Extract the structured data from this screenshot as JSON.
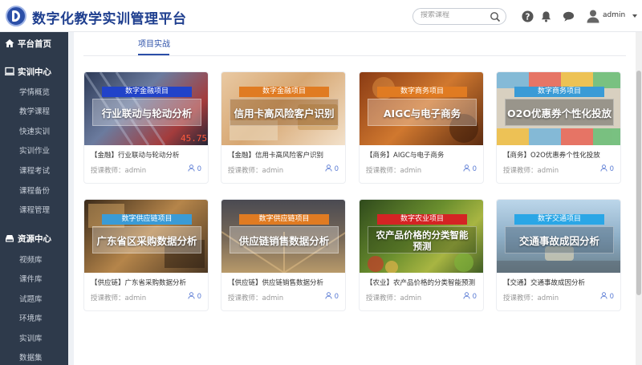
{
  "header": {
    "title": "数字化教学实训管理平台",
    "search_placeholder": "搜索课程",
    "user": "admin"
  },
  "sidebar": {
    "home": "平台首页",
    "sections": [
      {
        "label": "实训中心",
        "items": [
          "学情概览",
          "教学课程",
          "快速实训",
          "实训作业",
          "课程考试",
          "课程备份",
          "课程管理"
        ]
      },
      {
        "label": "资源中心",
        "items": [
          "视频库",
          "课件库",
          "试题库",
          "环境库",
          "实训库",
          "数据集"
        ]
      }
    ]
  },
  "main": {
    "tab": "项目实战",
    "cards": [
      {
        "tag": "数字金融项目",
        "cover_title": "行业联动与轮动分析",
        "name": "【金融】行业联动与轮动分析",
        "teacher": "授课教师：admin",
        "count": "0",
        "tag_color": "#2143c9"
      },
      {
        "tag": "数字金融项目",
        "cover_title": "信用卡高风险客户识别",
        "name": "【金融】信用卡高风险客户识别",
        "teacher": "授课教师：admin",
        "count": "0",
        "tag_color": "#e07b22"
      },
      {
        "tag": "数字商务项目",
        "cover_title": "AIGC与电子商务",
        "name": "【商务】AIGC与电子商务",
        "teacher": "授课教师：admin",
        "count": "0",
        "tag_color": "#e07b22"
      },
      {
        "tag": "数字商务项目",
        "cover_title": "O2O优惠券个性化投放",
        "name": "【商务】O2O优惠券个性化投放",
        "teacher": "授课教师：admin",
        "count": "0",
        "tag_color": "#3a9bd6"
      },
      {
        "tag": "数字供应链项目",
        "cover_title": "广东省区采购数据分析",
        "name": "【供应链】广东省采购数据分析",
        "teacher": "授课教师：admin",
        "count": "0",
        "tag_color": "#3a9bd6"
      },
      {
        "tag": "数字供应链项目",
        "cover_title": "供应链销售数据分析",
        "name": "【供应链】供应链销售数据分析",
        "teacher": "授课教师：admin",
        "count": "0",
        "tag_color": "#e07b22"
      },
      {
        "tag": "数字农业项目",
        "cover_title": "农产品价格的分类智能预测",
        "name": "【农业】农产品价格的分类智能预测",
        "teacher": "授课教师：admin",
        "count": "0",
        "tag_color": "#d42424"
      },
      {
        "tag": "数字交通项目",
        "cover_title": "交通事故成因分析",
        "name": "【交通】交通事故成因分析",
        "teacher": "授课教师：admin",
        "count": "0",
        "tag_color": "#2aa6e6"
      }
    ]
  }
}
